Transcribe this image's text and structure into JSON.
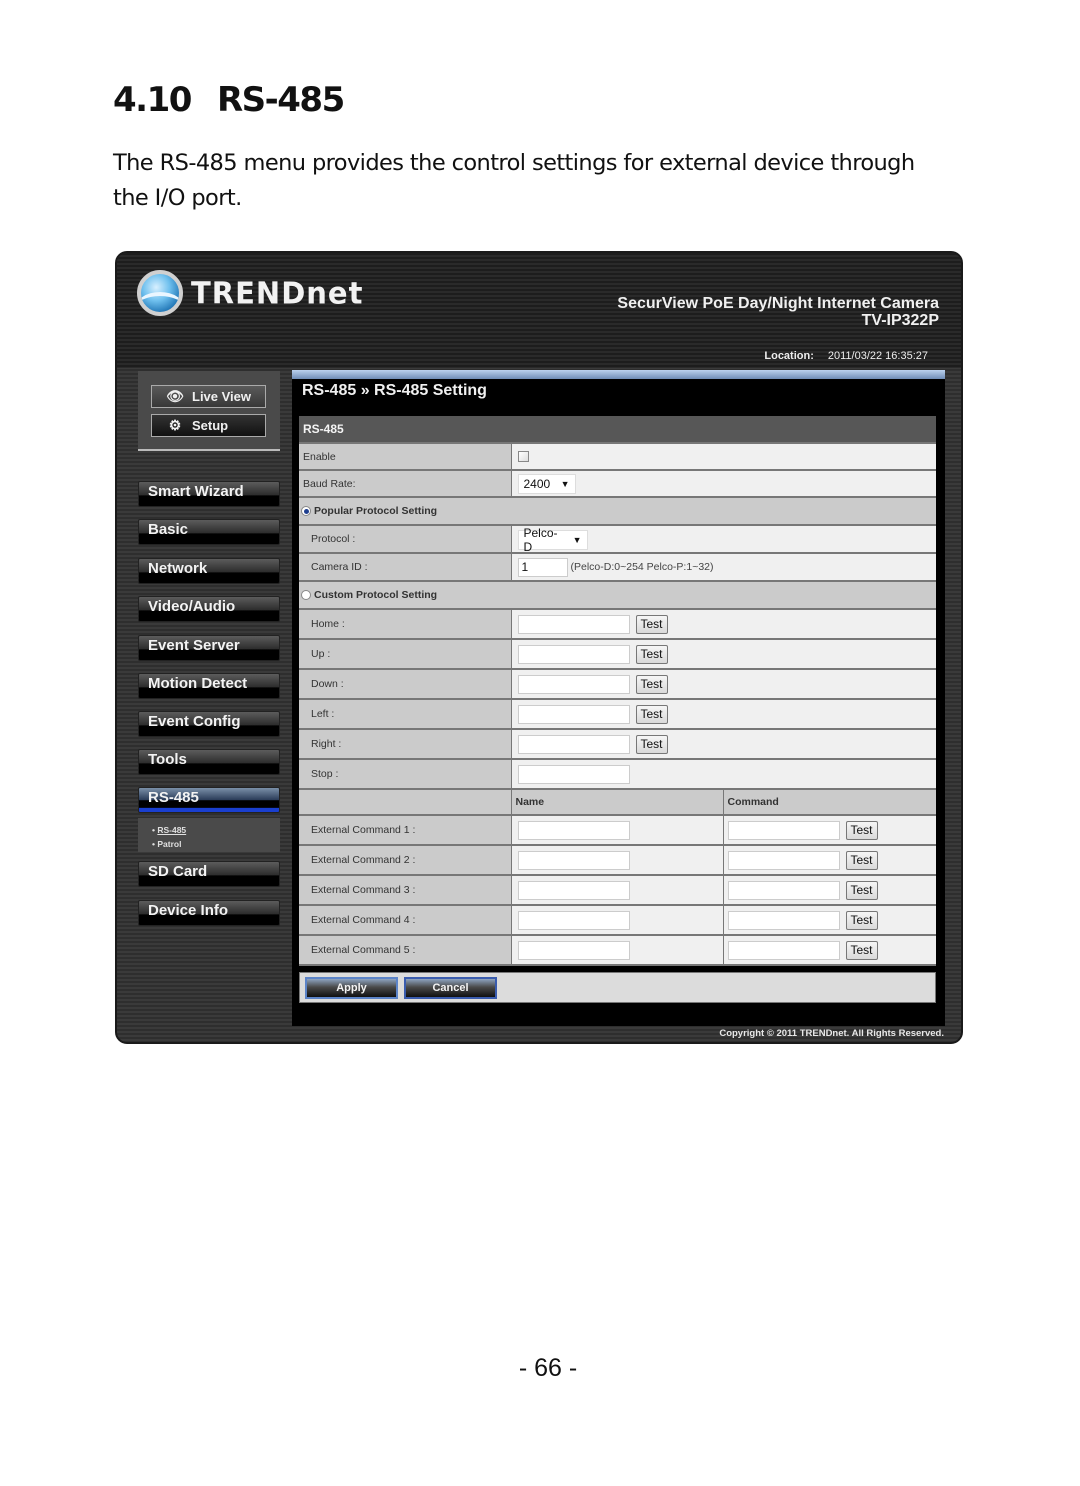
{
  "document": {
    "section_number": "4.10",
    "section_title": "RS-485",
    "intro": "The RS-485 menu provides the control settings for external device through the I/O port.",
    "page_number": "- 66 -"
  },
  "camera_ui": {
    "brand": "TRENDnet",
    "product_name": "SecurView PoE Day/Night Internet Camera",
    "model": "TV-IP322P",
    "location_label": "Location:",
    "timestamp": "2011/03/22 16:35:27",
    "view_buttons": [
      {
        "label": "Live View",
        "icon": "eye-icon"
      },
      {
        "label": "Setup",
        "icon": "gears-icon"
      }
    ],
    "nav": [
      {
        "label": "Smart Wizard",
        "active": false
      },
      {
        "label": "Basic",
        "active": false
      },
      {
        "label": "Network",
        "active": false
      },
      {
        "label": "Video/Audio",
        "active": false
      },
      {
        "label": "Event Server",
        "active": false
      },
      {
        "label": "Motion Detect",
        "active": false
      },
      {
        "label": "Event Config",
        "active": false
      },
      {
        "label": "Tools",
        "active": false
      },
      {
        "label": "RS-485",
        "active": true
      },
      {
        "label": "SD Card",
        "active": false
      },
      {
        "label": "Device Info",
        "active": false
      }
    ],
    "subnav": [
      {
        "label": "RS-485",
        "current": true
      },
      {
        "label": "Patrol",
        "current": false
      }
    ],
    "breadcrumb": "RS-485 » RS-485 Setting",
    "form": {
      "section_header": "RS-485",
      "enable_label": "Enable",
      "enable_checked": false,
      "baud_rate_label": "Baud Rate:",
      "baud_rate_value": "2400",
      "popular_protocol_label": "Popular Protocol Setting",
      "popular_selected": true,
      "protocol_label": "Protocol :",
      "protocol_value": "Pelco-D",
      "camera_id_label": "Camera ID :",
      "camera_id_value": "1",
      "camera_id_hint": "(Pelco-D:0~254 Pelco-P:1~32)",
      "custom_protocol_label": "Custom Protocol Setting",
      "custom_selected": false,
      "directions": [
        {
          "label": "Home :",
          "value": "",
          "has_test": true
        },
        {
          "label": "Up :",
          "value": "",
          "has_test": true
        },
        {
          "label": "Down :",
          "value": "",
          "has_test": true
        },
        {
          "label": "Left :",
          "value": "",
          "has_test": true
        },
        {
          "label": "Right :",
          "value": "",
          "has_test": true
        },
        {
          "label": "Stop :",
          "value": "",
          "has_test": false
        }
      ],
      "name_header": "Name",
      "command_header": "Command",
      "external_commands": [
        {
          "label": "External Command 1 :",
          "name": "",
          "command": ""
        },
        {
          "label": "External Command 2 :",
          "name": "",
          "command": ""
        },
        {
          "label": "External Command 3 :",
          "name": "",
          "command": ""
        },
        {
          "label": "External Command 4 :",
          "name": "",
          "command": ""
        },
        {
          "label": "External Command 5 :",
          "name": "",
          "command": ""
        }
      ],
      "test_label": "Test",
      "apply_label": "Apply",
      "cancel_label": "Cancel"
    },
    "copyright": "Copyright © 2011 TRENDnet. All Rights Reserved."
  }
}
